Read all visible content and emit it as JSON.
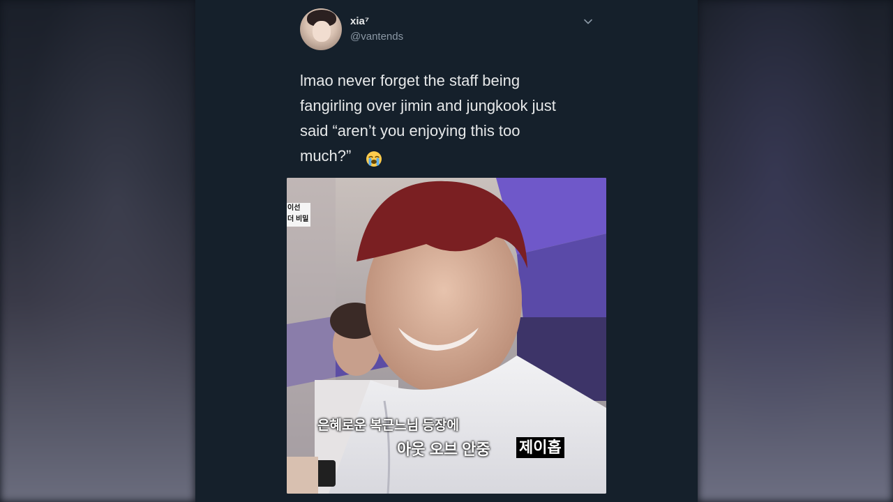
{
  "tweet": {
    "display_name": "xia⁷",
    "handle": "@vantends",
    "menu_icon": "chevron-down-icon",
    "text_lines": [
      "lmao never forget the staff being",
      "fangirling over jimin and jungkook just",
      "said “aren’t you enjoying this too",
      "much?”"
    ],
    "emoji": "loudly-crying-face-icon"
  },
  "media": {
    "corner_tag_lines": [
      "이선",
      "더 비밀"
    ],
    "caption_line_1": "은혜로운 복근느님 등장에",
    "caption_line_2": "아웃 오브 안중",
    "caption_name": "제이홉"
  },
  "colors": {
    "background": "#15202b",
    "text_primary": "#e7e9ea",
    "text_secondary": "#8b98a5"
  }
}
